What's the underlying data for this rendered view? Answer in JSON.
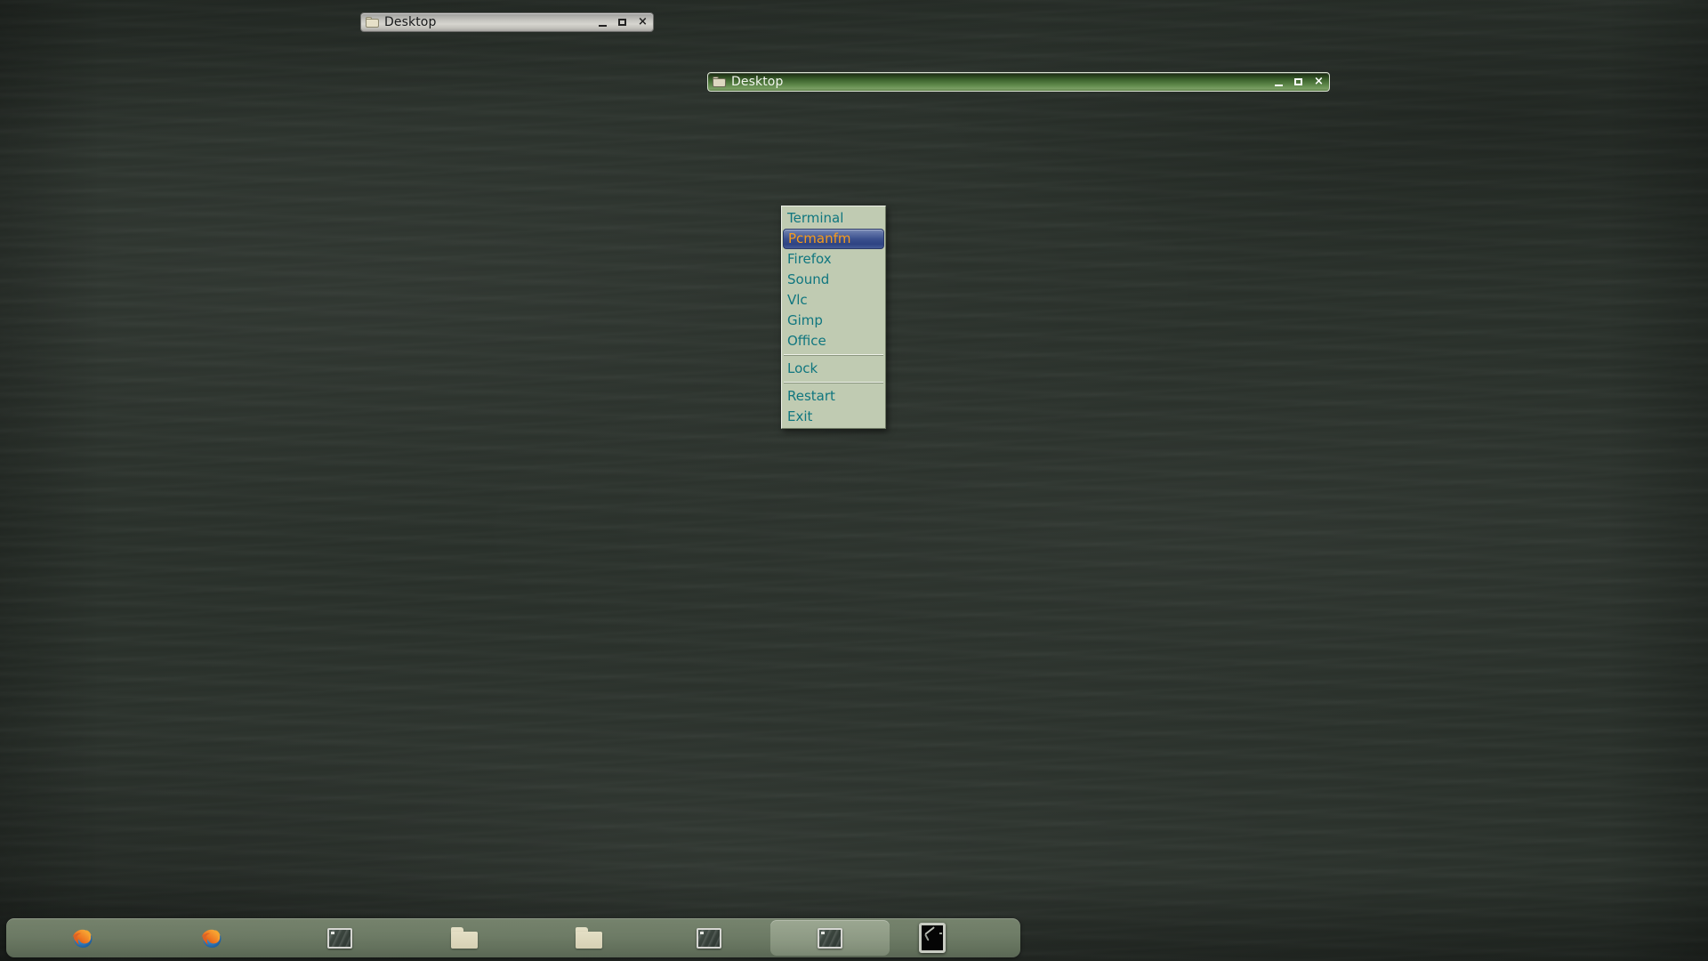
{
  "desktop": {
    "wallpaper_color": "#2b322c",
    "name": "desktop-wallpaper"
  },
  "windows": [
    {
      "title": "Desktop",
      "state": "inactive",
      "icon": "folder-icon",
      "buttons": {
        "minimize": "_",
        "maximize": "□",
        "close": "×"
      }
    },
    {
      "title": "Desktop",
      "state": "active",
      "icon": "folder-icon",
      "buttons": {
        "minimize": "_",
        "maximize": "□",
        "close": "×"
      }
    }
  ],
  "root_menu": {
    "name": "root-menu",
    "selected_index": 1,
    "colors": {
      "background": "#c0cbb2",
      "text": "#10767f",
      "selected_text": "#f79b1b",
      "selected_bg": "#3a4f8d"
    },
    "items": [
      {
        "label": "Terminal",
        "type": "item"
      },
      {
        "label": "Pcmanfm",
        "type": "item"
      },
      {
        "label": "Firefox",
        "type": "item"
      },
      {
        "label": "Sound",
        "type": "item"
      },
      {
        "label": "Vlc",
        "type": "item"
      },
      {
        "label": "Gimp",
        "type": "item"
      },
      {
        "label": "Office",
        "type": "item"
      },
      {
        "label": "",
        "type": "separator"
      },
      {
        "label": "Lock",
        "type": "item"
      },
      {
        "label": "",
        "type": "separator"
      },
      {
        "label": "Restart",
        "type": "item"
      },
      {
        "label": "Exit",
        "type": "item"
      }
    ]
  },
  "taskbar": {
    "name": "taskbar",
    "items": [
      {
        "icon": "firefox-icon",
        "active": false
      },
      {
        "icon": "firefox-icon",
        "active": false
      },
      {
        "icon": "terminal-icon",
        "active": false
      },
      {
        "icon": "folder-icon",
        "active": false
      },
      {
        "icon": "folder-icon",
        "active": false
      },
      {
        "icon": "terminal-icon",
        "active": false
      },
      {
        "icon": "terminal-icon",
        "active": true
      },
      {
        "icon": "window-thumbnail-icon",
        "active": false
      }
    ]
  }
}
